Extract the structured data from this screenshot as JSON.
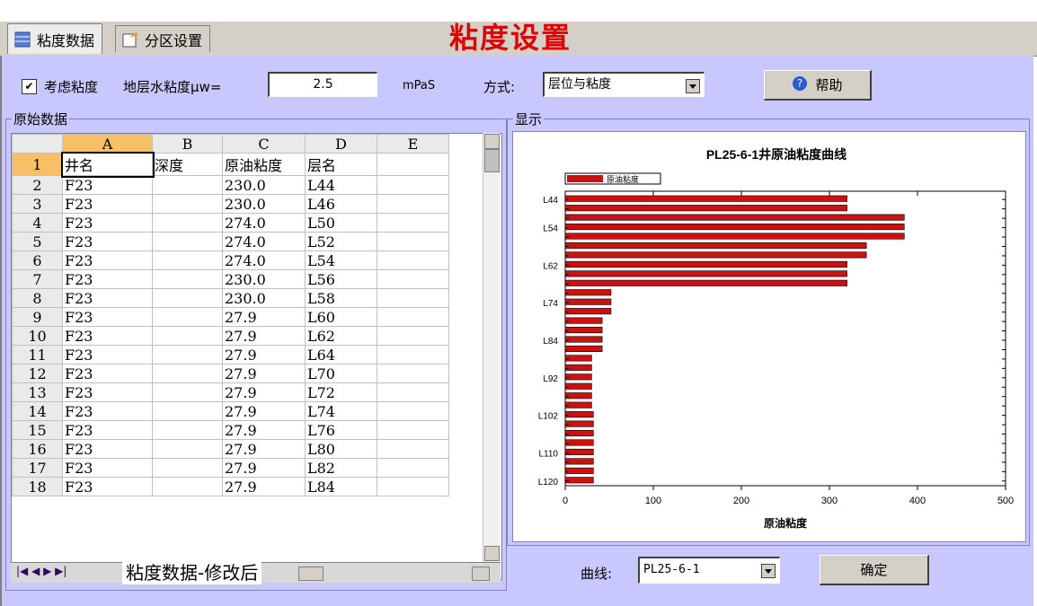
{
  "tabs": [
    {
      "label": "粘度数据",
      "icon": "table-icon",
      "active": true
    },
    {
      "label": "分区设置",
      "icon": "settings-icon",
      "active": false
    }
  ],
  "main_title": "粘度设置",
  "options": {
    "consider_viscosity_label": "考虑粘度",
    "consider_viscosity_checked": true,
    "water_visc_label": "地层水粘度μw=",
    "water_visc_value": "2.5",
    "water_visc_unit": "mPaS",
    "mode_label": "方式:",
    "mode_value": "层位与粘度",
    "help_label": "帮助"
  },
  "raw_group_label": "原始数据",
  "display_group_label": "显示",
  "sheet": {
    "columns": [
      "A",
      "B",
      "C",
      "D",
      "E"
    ],
    "rows": [
      {
        "n": "1",
        "cells": [
          "井名",
          "深度",
          "原油粘度",
          "层名",
          ""
        ]
      },
      {
        "n": "2",
        "cells": [
          "F23",
          "",
          "230.0",
          "L44",
          ""
        ]
      },
      {
        "n": "3",
        "cells": [
          "F23",
          "",
          "230.0",
          "L46",
          ""
        ]
      },
      {
        "n": "4",
        "cells": [
          "F23",
          "",
          "274.0",
          "L50",
          ""
        ]
      },
      {
        "n": "5",
        "cells": [
          "F23",
          "",
          "274.0",
          "L52",
          ""
        ]
      },
      {
        "n": "6",
        "cells": [
          "F23",
          "",
          "274.0",
          "L54",
          ""
        ]
      },
      {
        "n": "7",
        "cells": [
          "F23",
          "",
          "230.0",
          "L56",
          ""
        ]
      },
      {
        "n": "8",
        "cells": [
          "F23",
          "",
          "230.0",
          "L58",
          ""
        ]
      },
      {
        "n": "9",
        "cells": [
          "F23",
          "",
          "27.9",
          "L60",
          ""
        ]
      },
      {
        "n": "10",
        "cells": [
          "F23",
          "",
          "27.9",
          "L62",
          ""
        ]
      },
      {
        "n": "11",
        "cells": [
          "F23",
          "",
          "27.9",
          "L64",
          ""
        ]
      },
      {
        "n": "12",
        "cells": [
          "F23",
          "",
          "27.9",
          "L70",
          ""
        ]
      },
      {
        "n": "13",
        "cells": [
          "F23",
          "",
          "27.9",
          "L72",
          ""
        ]
      },
      {
        "n": "14",
        "cells": [
          "F23",
          "",
          "27.9",
          "L74",
          ""
        ]
      },
      {
        "n": "15",
        "cells": [
          "F23",
          "",
          "27.9",
          "L76",
          ""
        ]
      },
      {
        "n": "16",
        "cells": [
          "F23",
          "",
          "27.9",
          "L80",
          ""
        ]
      },
      {
        "n": "17",
        "cells": [
          "F23",
          "",
          "27.9",
          "L82",
          ""
        ]
      },
      {
        "n": "18",
        "cells": [
          "F23",
          "",
          "27.9",
          "L84",
          ""
        ]
      }
    ],
    "sheet_tab_label": "粘度数据-修改后"
  },
  "chart_data": {
    "type": "bar",
    "orientation": "horizontal",
    "title": "PL25-6-1井原油粘度曲线",
    "xlabel": "原油粘度",
    "ylabel": "",
    "xlim": [
      0,
      500
    ],
    "xticks": [
      0,
      100,
      200,
      300,
      400,
      500
    ],
    "ytick_labels": [
      "L44",
      "L54",
      "L62",
      "L74",
      "L84",
      "L92",
      "L102",
      "L110",
      "L120"
    ],
    "legend": "原油粘度",
    "legend_position": "top-left",
    "bar_color": "#cc1111",
    "values": [
      320,
      320,
      385,
      385,
      385,
      342,
      342,
      320,
      320,
      320,
      52,
      52,
      52,
      42,
      42,
      42,
      42,
      30,
      30,
      30,
      30,
      30,
      30,
      32,
      32,
      32,
      32,
      32,
      32,
      32,
      32
    ]
  },
  "curve": {
    "label": "曲线:",
    "value": "PL25-6-1",
    "ok_label": "确定"
  }
}
